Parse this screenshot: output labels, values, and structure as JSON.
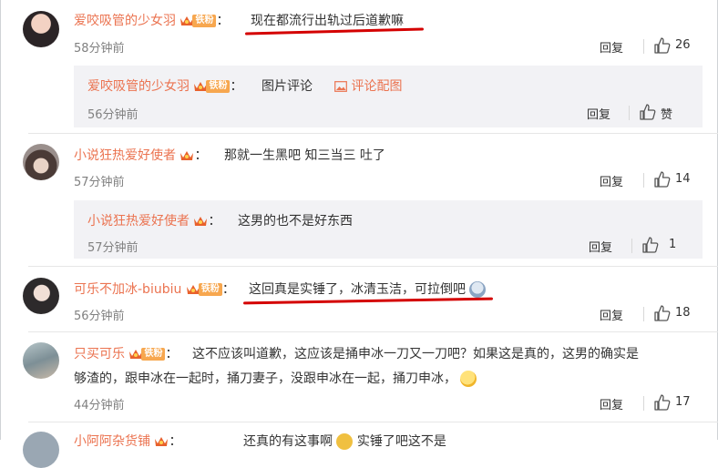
{
  "comments": [
    {
      "username": "爱咬吸管的少女羽",
      "fan_badge": "铁粉",
      "text": "现在都流行出轨过后道歉嘛",
      "time": "58分钟前",
      "reply_label": "回复",
      "like_count": "26",
      "subreply": {
        "username": "爱咬吸管的少女羽",
        "fan_badge": "铁粉",
        "text": "图片评论",
        "link_text": "评论配图",
        "time": "56分钟前",
        "reply_label": "回复",
        "like_label": "赞"
      }
    },
    {
      "username": "小说狂热爱好使者",
      "text": "那就一生黑吧 知三当三 吐了",
      "time": "57分钟前",
      "reply_label": "回复",
      "like_count": "14",
      "subreply": {
        "username": "小说狂热爱好使者",
        "text": "这男的也不是好东西",
        "time": "57分钟前",
        "reply_label": "回复",
        "like_count": "1"
      }
    },
    {
      "username": "可乐不加冰-biubiu",
      "fan_badge": "铁粉",
      "text": "这回真是实锤了，冰清玉洁，可拉倒吧",
      "time": "56分钟前",
      "reply_label": "回复",
      "like_count": "18"
    },
    {
      "username": "只买可乐",
      "fan_badge": "铁粉",
      "text_line1": "这不应该叫道歉，这应该是捅申冰一刀又一刀吧？如果这是真的，这男的确实是",
      "text_line2": "够渣的，跟申冰在一起时，捅刀妻子，没跟申冰在一起，捅刀申冰，",
      "time": "44分钟前",
      "reply_label": "回复",
      "like_count": "17"
    },
    {
      "username": "小阿阿杂货铺",
      "text": "还真的有这事啊",
      "text_tail": "实锤了吧这不是"
    }
  ],
  "colors": {
    "username": "#eb7350",
    "fan_badge": "#f7a74f",
    "subreply_bg": "#f2f2f5",
    "highlight": "#d40000"
  }
}
